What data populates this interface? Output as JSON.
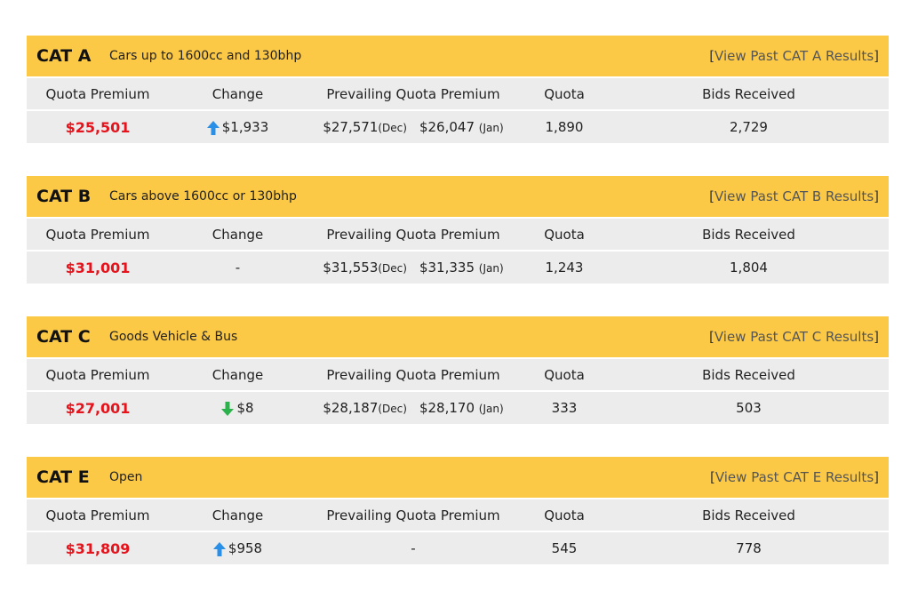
{
  "colors": {
    "header_bg": "#fcc947",
    "row_bg": "#ececec",
    "premium": "#e4131c",
    "arrow_up": "#2a8fe6",
    "arrow_down": "#2bb24c"
  },
  "labels": {
    "quota_premium": "Quota Premium",
    "change": "Change",
    "prevailing": "Prevailing Quota Premium",
    "quota": "Quota",
    "bids": "Bids Received"
  },
  "categories": [
    {
      "name": "CAT A",
      "desc": "Cars up to 1600cc and 130bhp",
      "link_open": "[",
      "link_text": "View Past CAT A Results",
      "link_close": "]",
      "premium": "$25,501",
      "change_icon": "arrow-up-icon",
      "change": "$1,933",
      "prev_dec": "$27,571",
      "prev_dec_label": "(Dec)",
      "prev_jan": "$26,047",
      "prev_jan_label": "(Jan)",
      "quota": "1,890",
      "bids": "2,729"
    },
    {
      "name": "CAT B",
      "desc": "Cars above 1600cc or 130bhp",
      "link_open": "[",
      "link_text": "View Past CAT B Results",
      "link_close": "]",
      "premium": "$31,001",
      "change_icon": "",
      "change": "-",
      "prev_dec": "$31,553",
      "prev_dec_label": "(Dec)",
      "prev_jan": "$31,335",
      "prev_jan_label": "(Jan)",
      "quota": "1,243",
      "bids": "1,804"
    },
    {
      "name": "CAT C",
      "desc": "Goods Vehicle & Bus",
      "link_open": "[",
      "link_text": "View Past CAT C Results",
      "link_close": "]",
      "premium": "$27,001",
      "change_icon": "arrow-down-icon",
      "change": "$8",
      "prev_dec": "$28,187",
      "prev_dec_label": "(Dec)",
      "prev_jan": "$28,170",
      "prev_jan_label": "(Jan)",
      "quota": "333",
      "bids": "503"
    },
    {
      "name": "CAT E",
      "desc": "Open",
      "link_open": "[",
      "link_text": "View Past CAT E Results",
      "link_close": "]",
      "premium": "$31,809",
      "change_icon": "arrow-up-icon",
      "change": "$958",
      "prev_single": "-",
      "quota": "545",
      "bids": "778"
    }
  ]
}
